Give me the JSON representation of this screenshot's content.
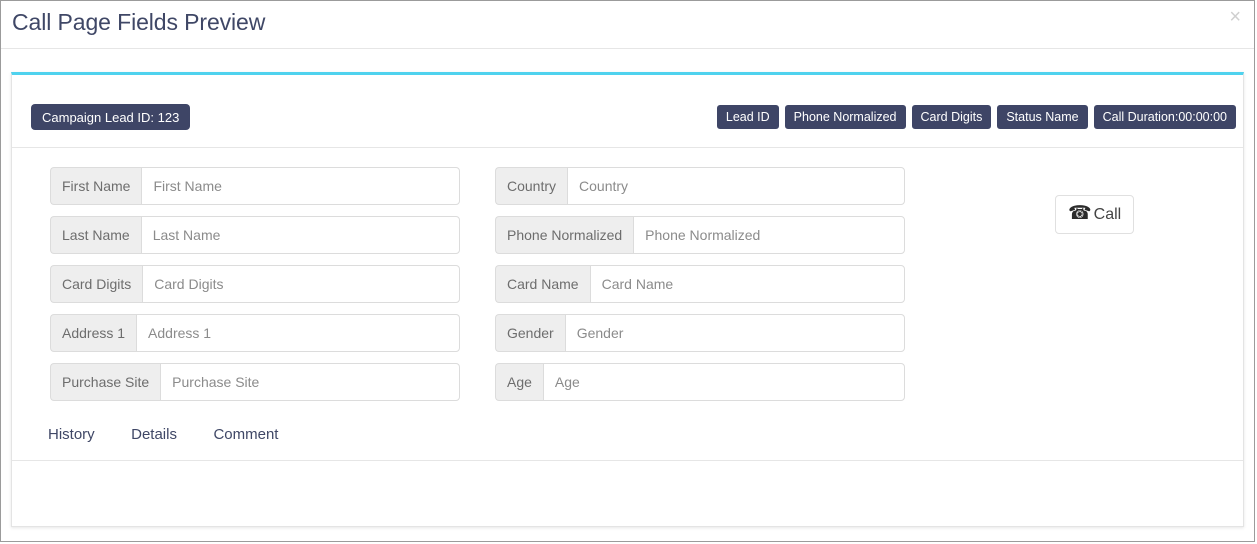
{
  "modal": {
    "title": "Call Page Fields Preview",
    "close_label": "×"
  },
  "badges": {
    "campaign": "Campaign Lead ID: 123",
    "right": [
      {
        "label": "Lead ID"
      },
      {
        "label": "Phone Normalized"
      },
      {
        "label": "Card Digits"
      },
      {
        "label": "Status Name"
      },
      {
        "label": "Call Duration:00:00:00"
      }
    ]
  },
  "fields": {
    "left": [
      {
        "label": "First Name",
        "placeholder": "First Name",
        "value": ""
      },
      {
        "label": "Last Name",
        "placeholder": "Last Name",
        "value": ""
      },
      {
        "label": "Card Digits",
        "placeholder": "Card Digits",
        "value": ""
      },
      {
        "label": "Address 1",
        "placeholder": "Address 1",
        "value": ""
      },
      {
        "label": "Purchase Site",
        "placeholder": "Purchase Site",
        "value": ""
      }
    ],
    "right": [
      {
        "label": "Country",
        "placeholder": "Country",
        "value": ""
      },
      {
        "label": "Phone Normalized",
        "placeholder": "Phone Normalized",
        "value": ""
      },
      {
        "label": "Card Name",
        "placeholder": "Card Name",
        "value": ""
      },
      {
        "label": "Gender",
        "placeholder": "Gender",
        "value": ""
      },
      {
        "label": "Age",
        "placeholder": "Age",
        "value": ""
      }
    ]
  },
  "call_button": {
    "label": "Call",
    "icon": "☎"
  },
  "tabs": [
    {
      "label": "History"
    },
    {
      "label": "Details"
    },
    {
      "label": "Comment"
    }
  ],
  "colors": {
    "accent": "#4fd2ee",
    "badge": "#3e4566",
    "title": "#3f4766",
    "prefix_bg": "#eeeeee",
    "border": "#dcdcdc"
  }
}
